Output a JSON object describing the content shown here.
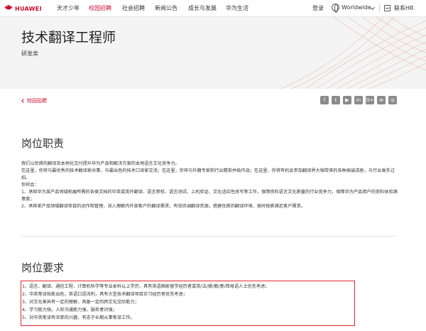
{
  "brand": {
    "logo_text": "HUAWEI",
    "accent_color": "#cf0a2c"
  },
  "nav": {
    "items": [
      "天才少年",
      "校园招聘",
      "社会招聘",
      "新闻公告",
      "成长与发展",
      "华为生活"
    ],
    "active": "校园招聘",
    "login": "登录",
    "region": "Worldwide",
    "contact_hr": "联系HR"
  },
  "job": {
    "title": "技术翻译工程师",
    "category": "研发类"
  },
  "breadcrumb": {
    "back_label": "校园招聘"
  },
  "share_icons": [
    "facebook-icon",
    "twitter-icon",
    "youtube-icon",
    "linkedin-icon",
    "google-plus-icon",
    "weibo-icon",
    "wechat-icon"
  ],
  "responsibilities": {
    "title": "岗位职责",
    "paragraphs": [
      "我们以优质的翻译及本地化交付提升华为产品和解决方案的本地语言文化竞争力。",
      "在这里，你将与最优秀的技术翻译家共事，与最出色的技术口译家交流；在这里，你将与外籍专家和行业精英并肩作战；在这里，你将有机会参加翻译界大咖带来的各种高端讲座，与行业高手过招。",
      "你将会：",
      "1、承担华为某产品领域拓展所需的各类文档的中英或英外翻译、语言审校、语言测试、上机验证、文化适应性改写等工作，保障资料语言文化质量的行业竞争力，保障华为产品用户的资料体验满意度；",
      "2、承担某产品领域翻译项目的运作和管理，深入理解内外部客户的翻译需求，有效协调翻译资源，搭建优质的翻译环境，按时按质满足客户需求。"
    ]
  },
  "requirements": {
    "title": "岗位要求",
    "items": [
      "1、语言、翻译、通信工程、计算机科学等专业本科以上学历，具有英语国家留学经历者或英/法/德/葡/意/西母语人士优先考虑；",
      "2、中英笔译技能出色，英语口语流利，具有大型技术翻译项目实习经历者优先考虑；",
      "3、对文化差异有一定的理解，具备一定的跨文化交际能力；",
      "4、学习能力强，人际沟通能力强，服务意识强；",
      "5、对中英笔译有浓厚的兴趣，有志于长期从事笔译工作。"
    ]
  }
}
